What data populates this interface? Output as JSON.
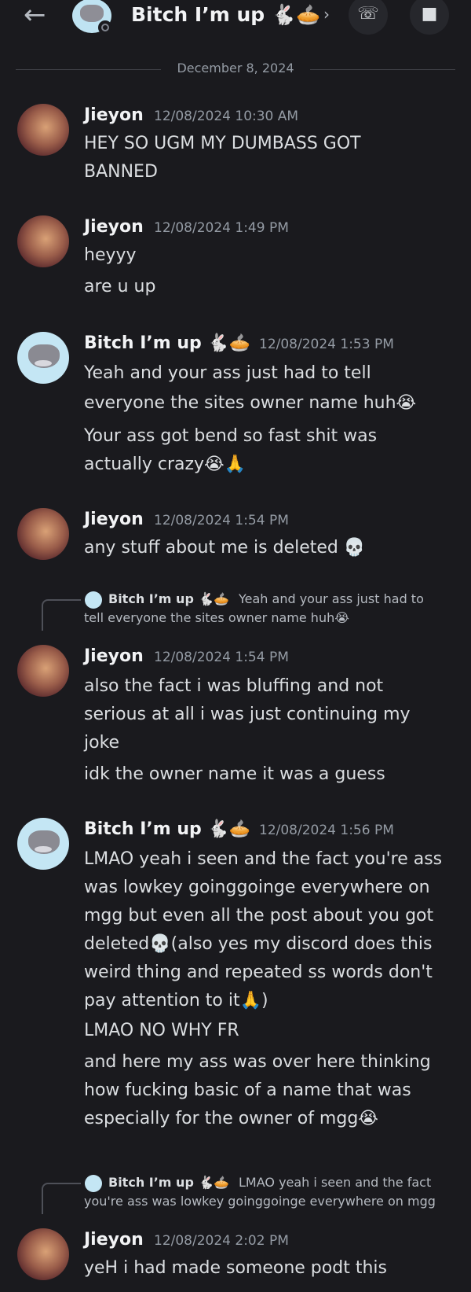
{
  "header": {
    "back_icon": "arrow-left-icon",
    "title": "Bitch I’m up 🐇🥧",
    "chevron": "›",
    "call_icon": "phone-call-icon",
    "video_icon": "video-camera-icon"
  },
  "date_divider": "December 8, 2024",
  "messages": [
    {
      "author": "Jieyon",
      "timestamp": "12/08/2024 10:30 AM",
      "lines": [
        "HEY SO UGM MY DUMBASS GOT",
        "BANNED"
      ]
    },
    {
      "author": "Jieyon",
      "timestamp": "12/08/2024 1:49 PM",
      "lines": [
        "heyyy",
        "are u up"
      ]
    },
    {
      "author": "Bitch I’m up 🐇🥧",
      "timestamp": "12/08/2024 1:53 PM",
      "lines": [
        "Yeah and your ass just had to tell",
        "everyone the sites owner name huh😭",
        "Your ass got bend so fast shit was",
        "actually crazy😭🙏"
      ]
    },
    {
      "author": "Jieyon",
      "timestamp": "12/08/2024 1:54 PM",
      "lines": [
        "any stuff about me is deleted 💀"
      ]
    },
    {
      "reply": {
        "author": "Bitch I’m up 🐇🥧",
        "line1": "Yeah and your ass just had to",
        "line2": "tell everyone the sites owner name huh😭"
      },
      "author": "Jieyon",
      "timestamp": "12/08/2024 1:54 PM",
      "lines": [
        "also the fact i was bluffing and not",
        "serious at all i was just continuing my",
        "joke",
        "idk the owner name it was a guess"
      ]
    },
    {
      "author": "Bitch I’m up 🐇🥧",
      "timestamp": "12/08/2024 1:56 PM",
      "lines": [
        "LMAO yeah i seen and the fact you're ass",
        "was lowkey goinggoinge everywhere on",
        "mgg but even all the post about you got",
        "deleted💀(also yes my discord does this",
        "weird thing and repeated ss words don't",
        "pay attention to it🙏)",
        "LMAO NO WHY FR",
        "and here my ass was over here thinking",
        "how fucking basic of a name that was",
        "especially for the owner of mgg😭"
      ]
    },
    {
      "reply": {
        "author": "Bitch I’m up 🐇🥧",
        "line1": "LMAO yeah i seen and the fact",
        "line2": "you're ass was lowkey goinggoinge everywhere on mgg"
      },
      "author": "Jieyon",
      "timestamp": "12/08/2024 2:02 PM",
      "lines": [
        "yeH i had made someone podt this"
      ]
    }
  ]
}
